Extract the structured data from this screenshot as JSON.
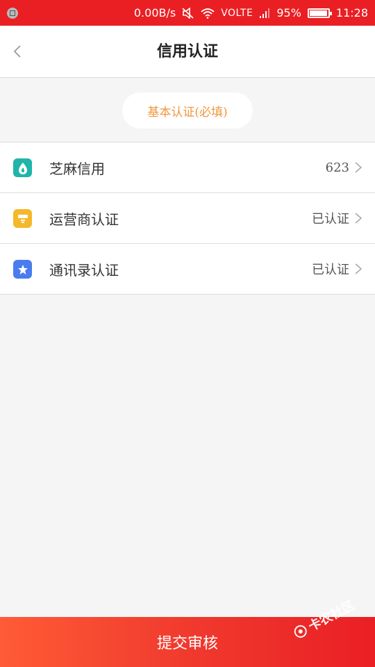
{
  "status_bar": {
    "net_speed": "0.00B/s",
    "volte": "VOLTE",
    "battery": "95%",
    "battery_level": 0.95,
    "time": "11:28"
  },
  "header": {
    "title": "信用认证"
  },
  "section": {
    "label": "基本认证(必填)"
  },
  "items": [
    {
      "label": "芝麻信用",
      "value": "623",
      "icon": "sesame-icon",
      "color": "#1fb5a8"
    },
    {
      "label": "运营商认证",
      "value": "已认证",
      "icon": "carrier-icon",
      "color": "#f5b82a"
    },
    {
      "label": "通讯录认证",
      "value": "已认证",
      "icon": "contacts-star-icon",
      "color": "#4a7cf0"
    }
  ],
  "submit": {
    "label": "提交审核"
  },
  "watermark": {
    "text": "卡农社区"
  },
  "colors": {
    "accent_red": "#ea1f24",
    "section_orange": "#f0963c"
  }
}
